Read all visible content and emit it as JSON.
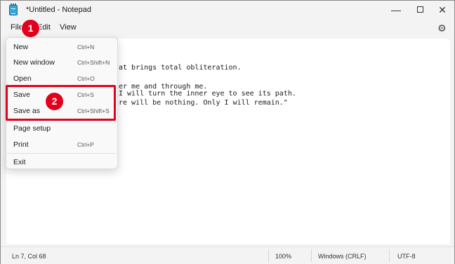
{
  "window": {
    "title": "*Untitled - Notepad",
    "minimize_glyph": "—",
    "close_glyph": "✕"
  },
  "menubar": {
    "file": "File",
    "edit": "Edit",
    "view": "View",
    "settings_glyph": "⚙"
  },
  "editor": {
    "visible_lines": [
      "at brings total obliteration.",
      "er me and through me.",
      "I will turn the inner eye to see its path.",
      "re will be nothing. Only I will remain.\""
    ]
  },
  "file_menu": {
    "items": [
      {
        "label": "New",
        "shortcut": "Ctrl+N"
      },
      {
        "label": "New window",
        "shortcut": "Ctrl+Shift+N"
      },
      {
        "label": "Open",
        "shortcut": "Ctrl+O"
      },
      {
        "label": "Save",
        "shortcut": "Ctrl+S"
      },
      {
        "label": "Save as",
        "shortcut": "Ctrl+Shift+S"
      },
      {
        "label": "Page setup",
        "shortcut": ""
      },
      {
        "label": "Print",
        "shortcut": "Ctrl+P"
      },
      {
        "label": "Exit",
        "shortcut": ""
      }
    ]
  },
  "statusbar": {
    "position": "Ln 7, Col 68",
    "zoom": "100%",
    "line_endings": "Windows (CRLF)",
    "encoding": "UTF-8"
  },
  "annotations": {
    "step1": "1",
    "step2": "2",
    "accent_color": "#e3001b"
  }
}
